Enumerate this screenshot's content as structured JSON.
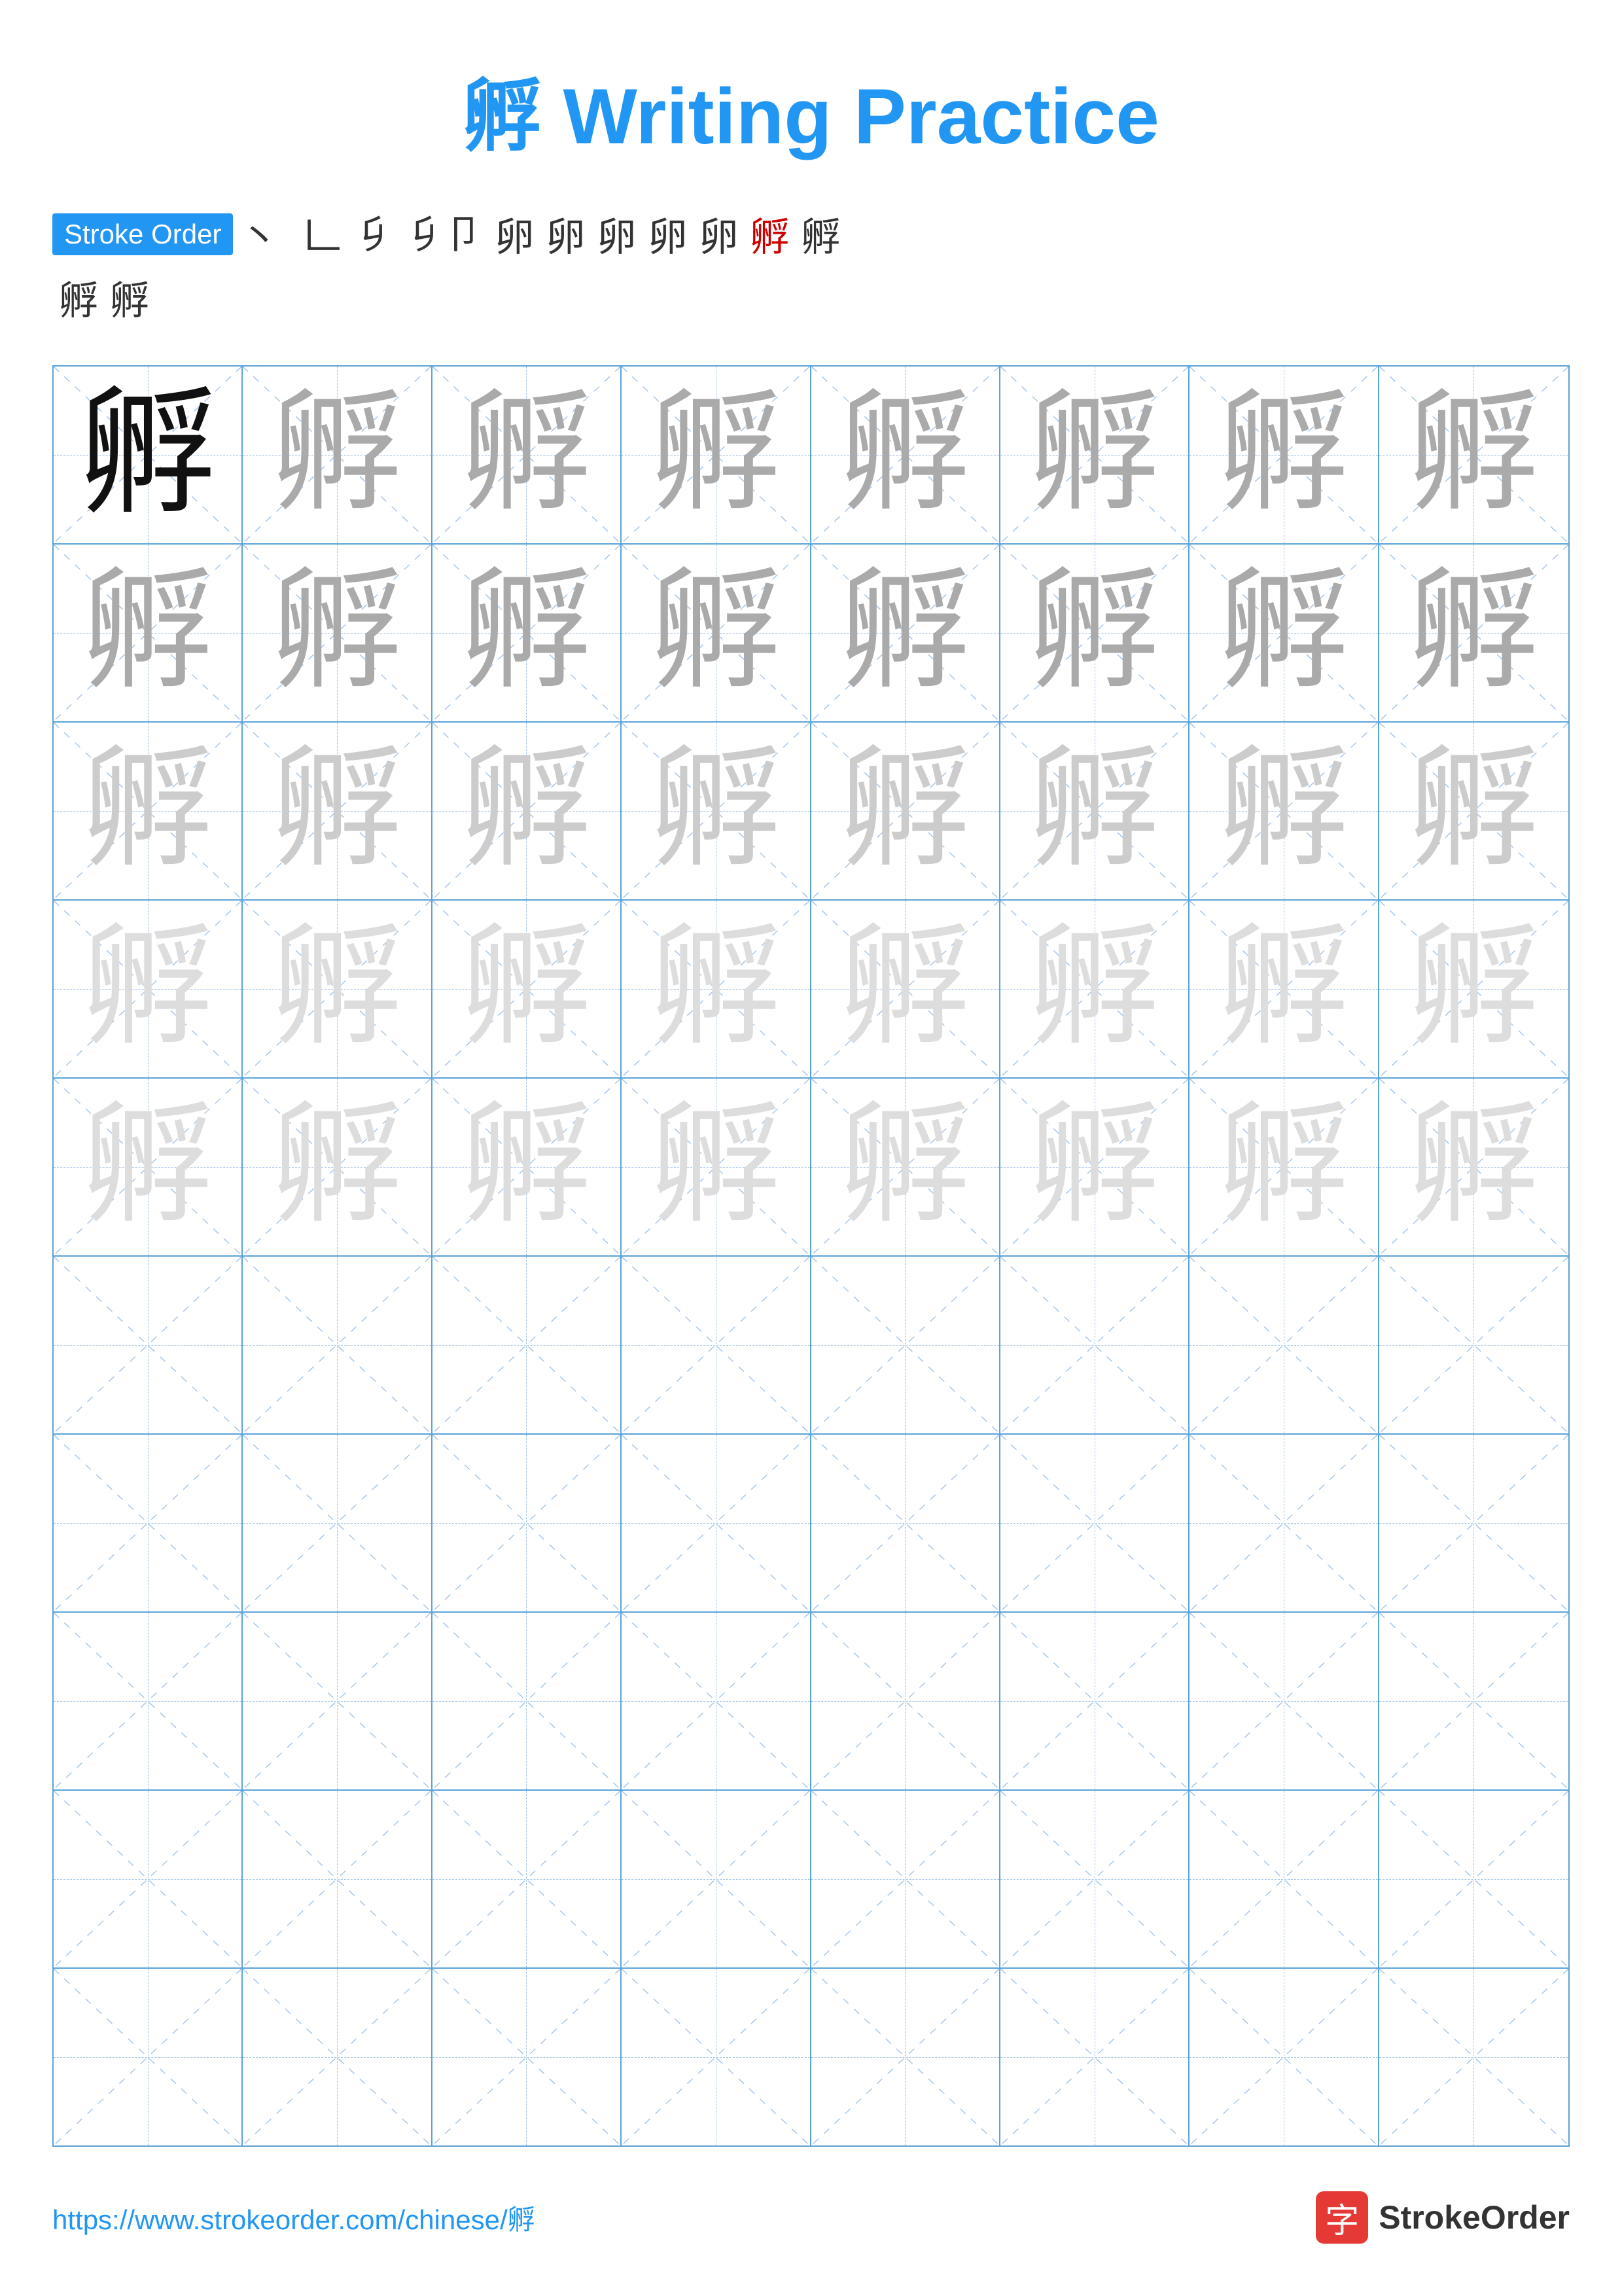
{
  "title": {
    "char": "孵",
    "text": " Writing Practice"
  },
  "stroke_order": {
    "badge_label": "Stroke Order",
    "chars": [
      "丶",
      "𠃌",
      "𠃊",
      "𠃑",
      "𠃍卩",
      "卵",
      "卵",
      "卵",
      "卵",
      "卵",
      "卵孵",
      "孵孵"
    ],
    "row2": [
      "孵",
      "孵"
    ]
  },
  "grid": {
    "rows": 10,
    "cols": 8,
    "char": "孵"
  },
  "footer": {
    "url": "https://www.strokeorder.com/chinese/孵",
    "logo_char": "字",
    "logo_name": "StrokeOrder"
  }
}
